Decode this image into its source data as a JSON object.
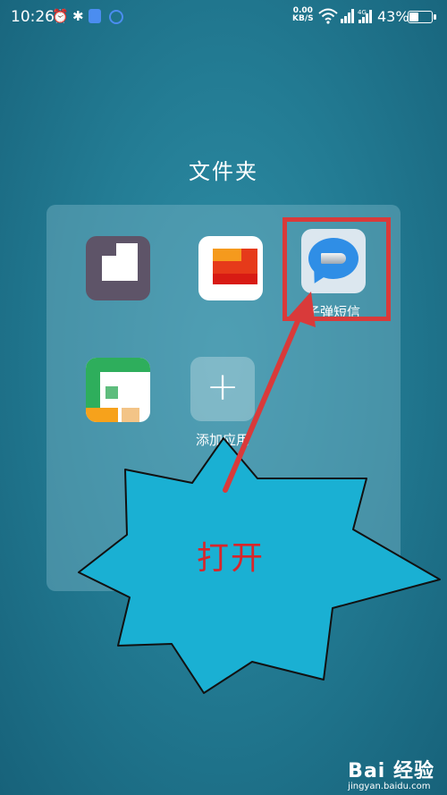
{
  "status_bar": {
    "time": "10:26",
    "netspeed_value": "0.00",
    "netspeed_unit": "KB/S",
    "battery": "43%",
    "icons": [
      "alarm-icon",
      "bluetooth-icon",
      "shield-icon",
      "circle-icon",
      "wifi-icon",
      "signal-icon",
      "4g-signal-icon",
      "battery-icon"
    ]
  },
  "folder": {
    "title": "文件夹",
    "apps": [
      {
        "label": "",
        "icon": "mosaic-app-icon"
      },
      {
        "label": "",
        "icon": "mosaic-app-icon"
      },
      {
        "label": "子弹短信",
        "icon": "bullet-sms-icon"
      },
      {
        "label": "",
        "icon": "mosaic-app-icon"
      },
      {
        "label": "添加应用",
        "icon": "plus-icon"
      }
    ]
  },
  "annotation": {
    "callout_text": "打开",
    "highlight_color": "#d93a3a",
    "callout_fill": "#1ab0d3"
  },
  "watermark": {
    "main": "Bai 经验",
    "sub": "jingyan.baidu.com"
  }
}
